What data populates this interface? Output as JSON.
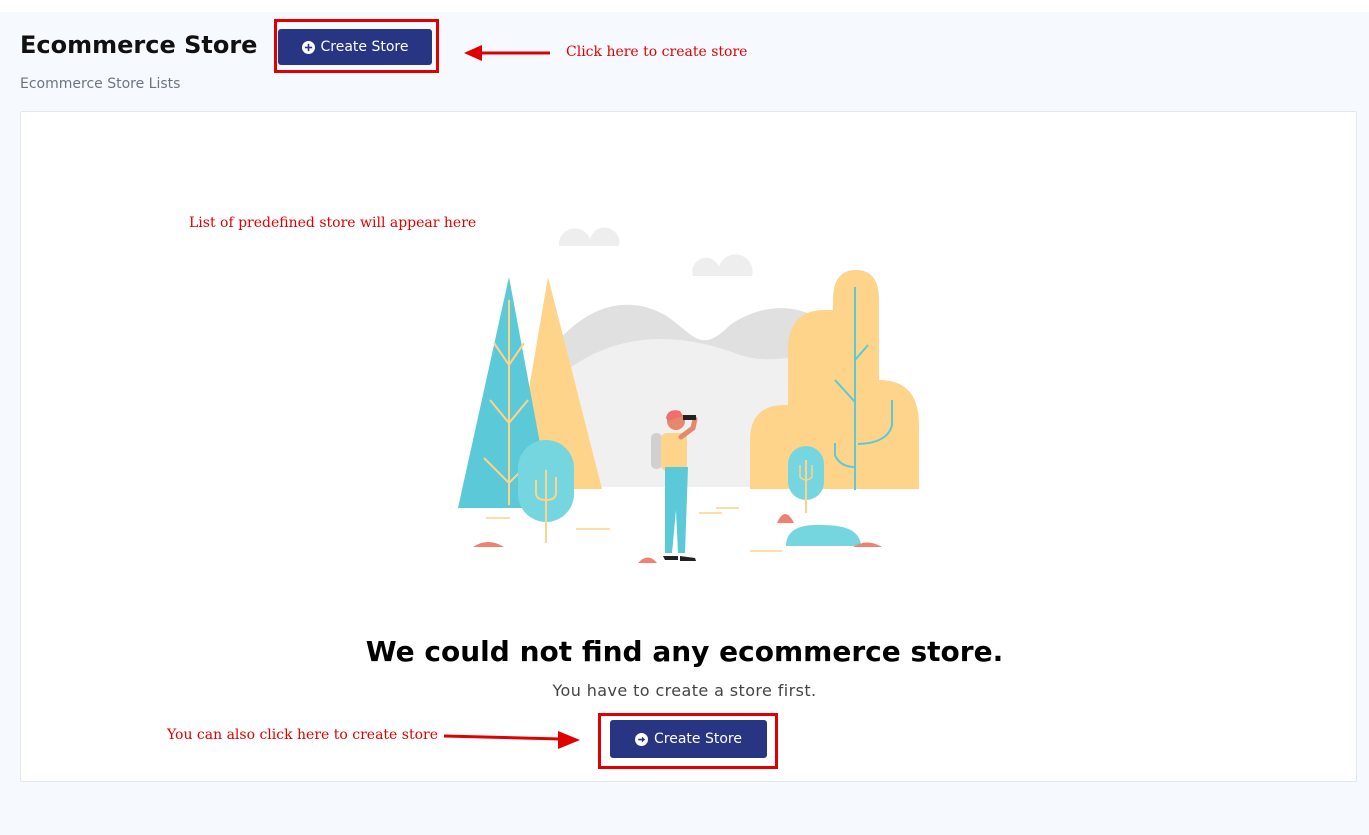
{
  "header": {
    "title": "Ecommerce Store",
    "subtitle": "Ecommerce Store Lists",
    "create_button": {
      "label": "Create Store",
      "icon": "plus-circle-icon"
    }
  },
  "empty_state": {
    "heading": "We could not find any ecommerce store.",
    "message": "You have to create a store first.",
    "create_button": {
      "label": "Create Store",
      "icon": "arrow-right-circle-icon"
    },
    "illustration": "person-with-binoculars-in-forest"
  },
  "annotations": {
    "top": "Click here to create store",
    "middle": "List of predefined store will appear here",
    "bottom": "You can also click here to create store"
  },
  "colors": {
    "primary_button": "#283583",
    "annotation_red": "#e00000",
    "page_background": "#f6f9fd"
  }
}
